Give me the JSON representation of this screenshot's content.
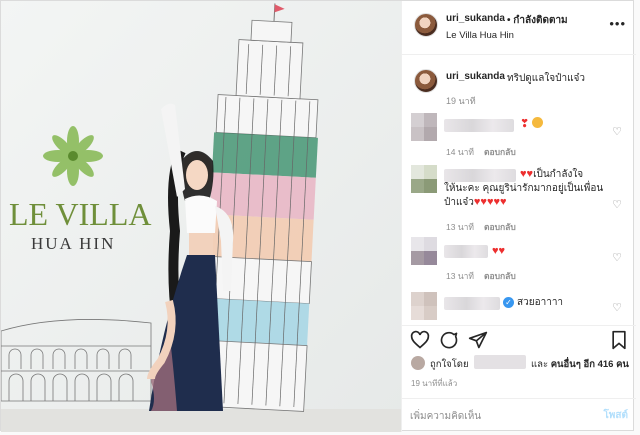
{
  "header": {
    "username": "uri_sukanda",
    "follow_status": "• กำลังติดตาม",
    "location": "Le Villa Hua Hin"
  },
  "photo": {
    "logo_line1": "LE VILLA",
    "logo_line2": "HUA HIN"
  },
  "caption": {
    "username": "uri_sukanda",
    "text": "ทริปดูแลใจป๋าแจ๋ว",
    "time": "19 นาที"
  },
  "comments": [
    {
      "name": "████████",
      "text": "",
      "hearts": 1,
      "extra_icon": "heart-eyes-emoji",
      "time": "14 นาที",
      "reply": "ตอบกลับ"
    },
    {
      "name": "████████",
      "text_line1": "เป็นกำลังใจ",
      "text_line2": "ให้นะคะ คุณยูริน่ารักมากอยู่เป็นเพื่อน",
      "text_line3": "ป๋าแจ๋ว",
      "hearts_line1": 2,
      "hearts_line3": 5,
      "time": "13 นาที",
      "reply": "ตอบกลับ"
    },
    {
      "name": "█████",
      "text": "",
      "hearts": 2,
      "time": "13 นาที",
      "reply": "ตอบกลับ"
    },
    {
      "name": "██████████",
      "text": "สวยอาาาา",
      "verified": true
    }
  ],
  "actions": {
    "liked_by_prefix": "ถูกใจโดย",
    "liked_by_user": "███████",
    "liked_by_and": "และ",
    "liked_by_others": "คนอื่นๆ อีก 416 คน",
    "post_time": "19 นาทีที่แล้ว"
  },
  "compose": {
    "placeholder": "เพิ่มความคิดเห็น",
    "post_label": "โพสต์"
  },
  "icons": [
    "more-icon",
    "heart-icon",
    "comment-icon",
    "share-icon",
    "bookmark-icon",
    "verified-icon"
  ],
  "colors": {
    "link_blue": "#3897f0",
    "post_disabled": "#b2dffc",
    "heart_red": "#ed2f2f",
    "logo_green": "#6f8f3a"
  }
}
